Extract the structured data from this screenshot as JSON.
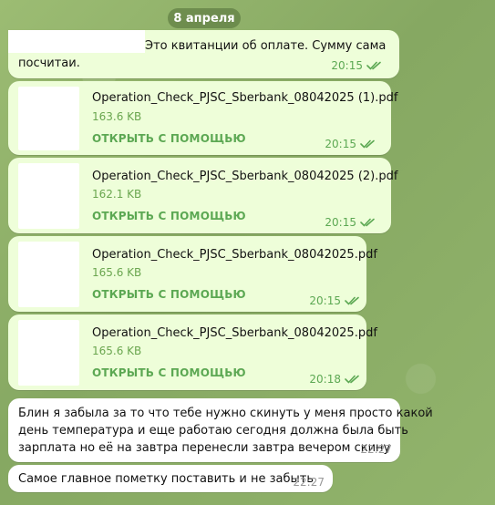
{
  "date": "8 апреля",
  "messages": {
    "first": {
      "text_line1": "Это квитанции об оплате. Сумму сама",
      "text_line2": "посчитаи.",
      "time": "20:15"
    },
    "files": [
      {
        "name": "Operation_Check_PJSC_Sberbank_08042025 (1).pdf",
        "size": "163.6 KB",
        "action": "ОТКРЫТЬ С ПОМОЩЬЮ",
        "time": "20:15"
      },
      {
        "name": "Operation_Check_PJSC_Sberbank_08042025 (2).pdf",
        "size": "162.1 KB",
        "action": "ОТКРЫТЬ С ПОМОЩЬЮ",
        "time": "20:15"
      },
      {
        "name": "Operation_Check_PJSC_Sberbank_08042025.pdf",
        "size": "165.6 KB",
        "action": "ОТКРЫТЬ С ПОМОЩЬЮ",
        "time": "20:15"
      },
      {
        "name": "Operation_Check_PJSC_Sberbank_08042025.pdf",
        "size": "165.6 KB",
        "action": "ОТКРЫТЬ С ПОМОЩЬЮ",
        "time": "20:18"
      }
    ],
    "incoming1": {
      "line1": "Блин я забыла за то что тебе нужно скинуть у меня просто какой",
      "line2": "день температура и еще работаю сегодня должна была быть",
      "line3": "зарплата но её на завтра перенесли завтра вечером скину",
      "time": "22:27"
    },
    "incoming2": {
      "text": "Самое главное пометку поставить и не забыть",
      "time": "22:27"
    }
  },
  "colors": {
    "outgoing": "#eefed9",
    "incoming": "#ffffff",
    "accent": "#5ca853"
  },
  "icons": [
    "double-check-icon"
  ]
}
